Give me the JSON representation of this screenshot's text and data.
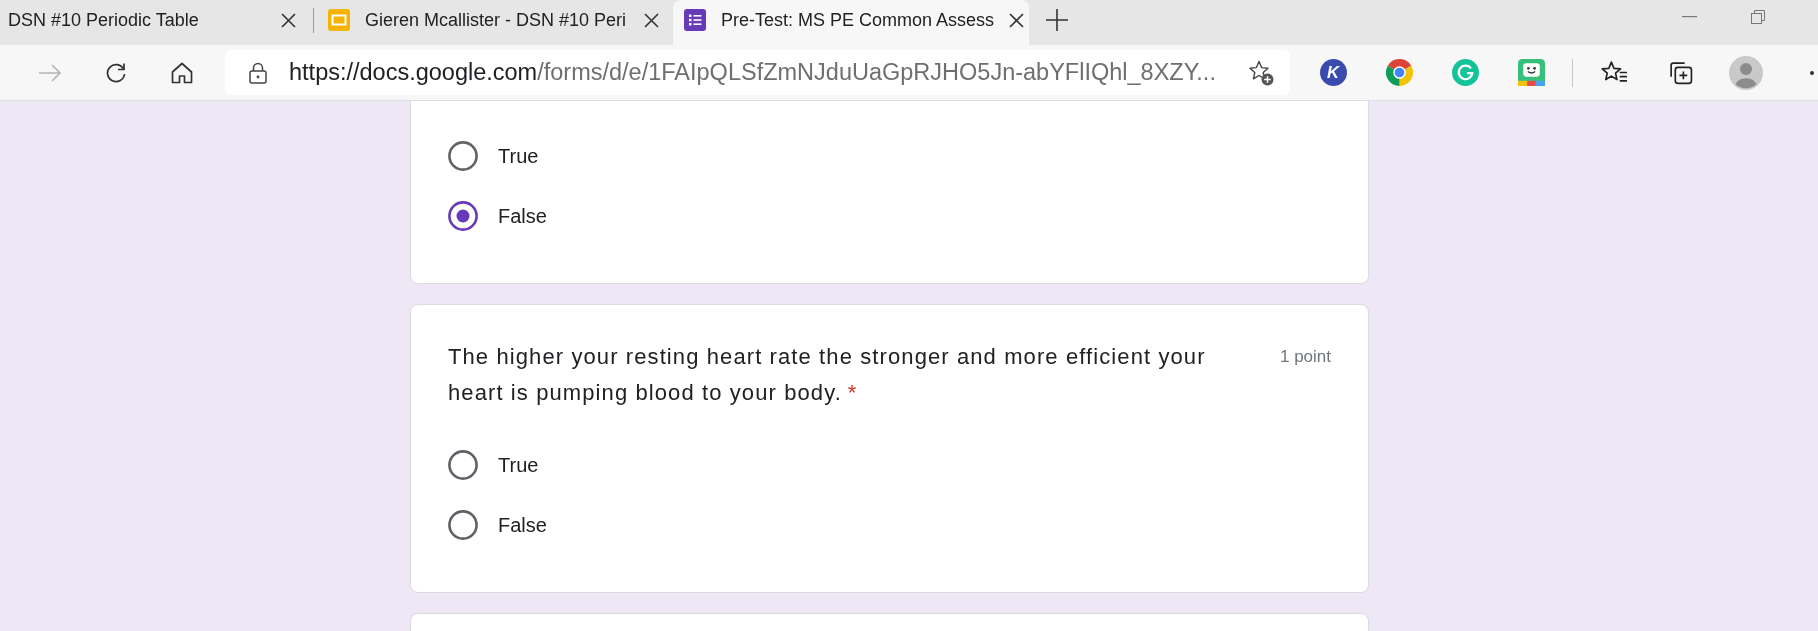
{
  "browser": {
    "tabs": [
      {
        "kind": "page",
        "title": "DSN #10 Periodic Table",
        "selected": false
      },
      {
        "kind": "slides",
        "title": "Gieren Mcallister - DSN #10 Peri",
        "selected": false
      },
      {
        "kind": "forms",
        "title": "Pre-Test: MS PE Common Assess",
        "selected": true
      }
    ],
    "forward_disabled": true,
    "address": {
      "host": "https://docs.google.com",
      "path": "/forms/d/e/1FAIpQLSfZmNJduUaGpRJHO5Jn-abYFlIQhl_8XZY..."
    },
    "extensions": [
      {
        "kind": "letter",
        "label": "K"
      },
      {
        "kind": "wheel"
      },
      {
        "kind": "ring"
      },
      {
        "kind": "face"
      }
    ]
  },
  "form": {
    "questions": [
      {
        "options": [
          {
            "label": "True",
            "selected": false
          },
          {
            "label": "False",
            "selected": true
          }
        ]
      },
      {
        "title": "The higher your resting heart rate the stronger and more efficient your heart is pumping blood to your body.",
        "required_mark": "*",
        "points": "1 point",
        "options": [
          {
            "label": "True",
            "selected": false
          },
          {
            "label": "False",
            "selected": false
          }
        ]
      }
    ],
    "more_below": true
  }
}
